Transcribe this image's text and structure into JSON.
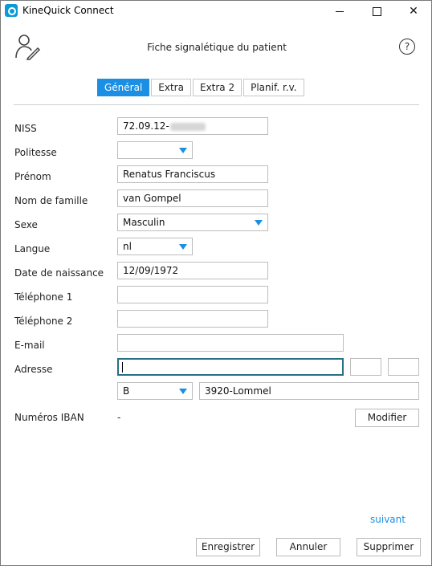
{
  "window": {
    "title": "KineQuick Connect",
    "minimize": "",
    "maximize": "",
    "close": "✕"
  },
  "header": {
    "title": "Fiche signalétique du patient",
    "help": "?"
  },
  "tabs": [
    {
      "label": "Général",
      "active": true
    },
    {
      "label": "Extra",
      "active": false
    },
    {
      "label": "Extra 2",
      "active": false
    },
    {
      "label": "Planif. r.v.",
      "active": false
    }
  ],
  "form": {
    "niss": {
      "label": "NISS",
      "value": "72.09.12-"
    },
    "politesse": {
      "label": "Politesse",
      "value": ""
    },
    "prenom": {
      "label": "Prénom",
      "value": "Renatus Franciscus"
    },
    "nom": {
      "label": "Nom de famille",
      "value": "van Gompel"
    },
    "sexe": {
      "label": "Sexe",
      "value": "Masculin"
    },
    "langue": {
      "label": "Langue",
      "value": "nl"
    },
    "naissance": {
      "label": "Date de naissance",
      "value": "12/09/1972"
    },
    "tel1": {
      "label": "Téléphone 1",
      "value": ""
    },
    "tel2": {
      "label": "Téléphone 2",
      "value": ""
    },
    "email": {
      "label": "E-mail",
      "value": ""
    },
    "adresse": {
      "label": "Adresse",
      "street": "",
      "number": "",
      "box": "",
      "country": "B",
      "city": "3920-Lommel"
    },
    "iban": {
      "label": "Numéros IBAN",
      "value": "-",
      "modify": "Modifier"
    }
  },
  "footer": {
    "next": "suivant",
    "save": "Enregistrer",
    "cancel": "Annuler",
    "delete": "Supprimer"
  },
  "colors": {
    "accent": "#1a8fe3",
    "focus_border": "#2a6d86"
  }
}
